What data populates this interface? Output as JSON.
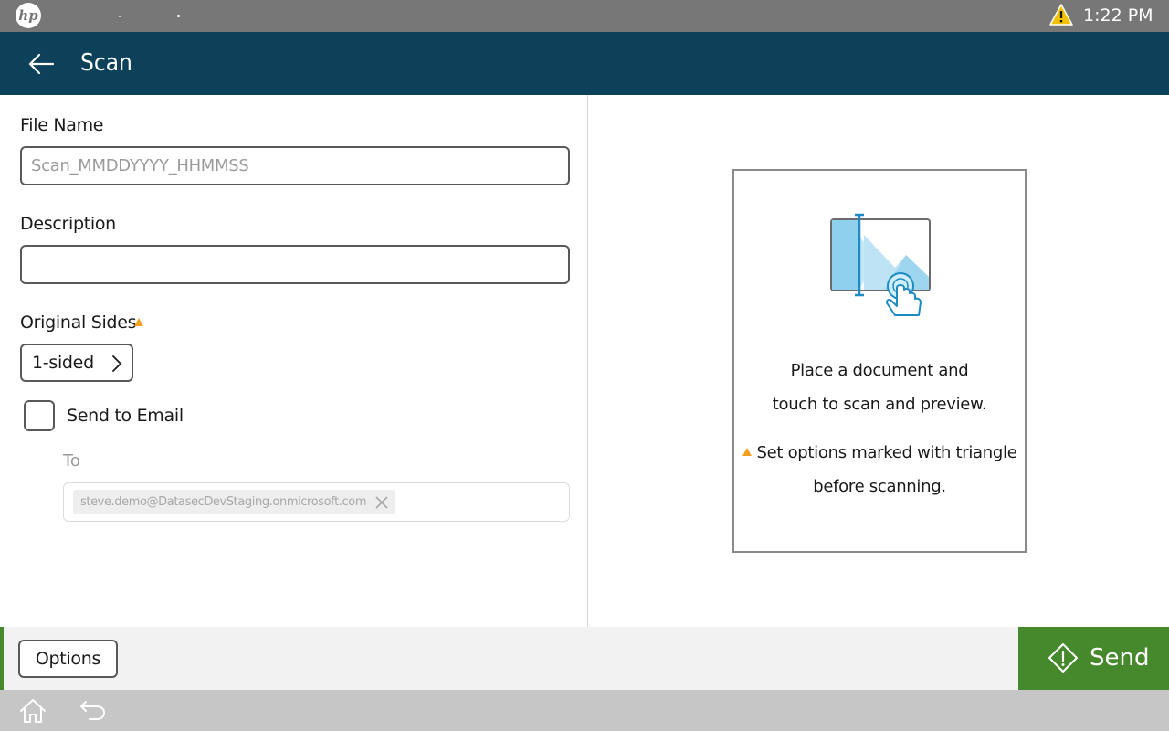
{
  "status_bar": {
    "logo_text": "hp",
    "time": "1:22 PM",
    "warning_icon": "warning-triangle-icon",
    "warning_color": "#f2c200"
  },
  "header": {
    "title": "Scan",
    "back_icon": "back-arrow-icon",
    "background": "#0c4159"
  },
  "form": {
    "file_name": {
      "label": "File Name",
      "placeholder": "Scan_MMDDYYYY_HHMMSS",
      "value": ""
    },
    "description": {
      "label": "Description",
      "placeholder": "",
      "value": ""
    },
    "original_sides": {
      "label": "Original Sides",
      "value": "1-sided",
      "needs_attention": true
    },
    "send_to_email": {
      "label": "Send to Email",
      "checked": false
    },
    "to": {
      "label": "To",
      "recipients": [
        "steve.demo@DatasecDevStaging.onmicrosoft.com"
      ]
    }
  },
  "preview": {
    "line1": "Place a document and",
    "line2": "touch to scan and preview.",
    "note_line1": "Set options marked with triangle",
    "note_line2": "before scanning.",
    "illustration_icon": "scan-preview-touch-icon"
  },
  "bottom_bar": {
    "options_label": "Options",
    "send_label": "Send",
    "send_color": "#46892c"
  },
  "nav_bar": {
    "home_icon": "home-icon",
    "back_icon": "undo-back-icon"
  }
}
